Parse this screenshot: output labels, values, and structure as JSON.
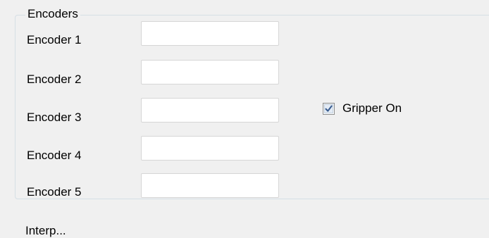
{
  "encoders_group": {
    "title": "Encoders",
    "fields": [
      {
        "label": "Encoder 1",
        "value": ""
      },
      {
        "label": "Encoder 2",
        "value": ""
      },
      {
        "label": "Encoder 3",
        "value": ""
      },
      {
        "label": "Encoder 4",
        "value": ""
      },
      {
        "label": "Encoder 5",
        "value": ""
      }
    ],
    "gripper": {
      "label": "Gripper On",
      "checked": true
    }
  },
  "next_group": {
    "title": "Interp..."
  },
  "icons": {
    "gripper_checkbox_mark": "checkmark-icon"
  },
  "colors": {
    "window_background": "#f0f0f0",
    "groupbox_border": "#d5dfe5",
    "textbox_border": "#d6d6d6",
    "checkmark": "#3a5d8f"
  }
}
